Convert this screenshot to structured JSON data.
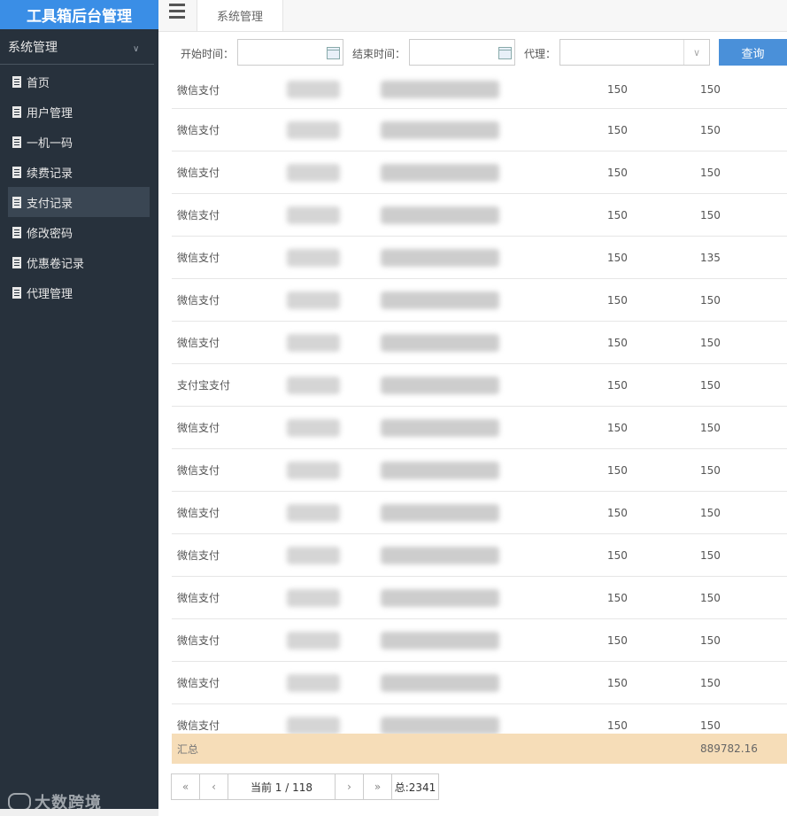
{
  "app": {
    "title": "工具箱后台管理"
  },
  "sidebar": {
    "group_label": "系统管理",
    "items": [
      {
        "label": "首页"
      },
      {
        "label": "用户管理"
      },
      {
        "label": "一机一码"
      },
      {
        "label": "续费记录"
      },
      {
        "label": "支付记录",
        "active": true
      },
      {
        "label": "修改密码"
      },
      {
        "label": "优惠卷记录"
      },
      {
        "label": "代理管理"
      }
    ],
    "watermark": "大数跨境"
  },
  "topbar": {
    "tab_label": "系统管理"
  },
  "filter": {
    "start_label": "开始时间：",
    "start_value": "",
    "end_label": "结束时间：",
    "end_value": "",
    "agent_label": "代理：",
    "agent_value": "",
    "query_label": "查询"
  },
  "table": {
    "rows": [
      {
        "method": "微信支付",
        "col3": "150",
        "col4": "150"
      },
      {
        "method": "微信支付",
        "col3": "150",
        "col4": "150"
      },
      {
        "method": "微信支付",
        "col3": "150",
        "col4": "150"
      },
      {
        "method": "微信支付",
        "col3": "150",
        "col4": "150"
      },
      {
        "method": "微信支付",
        "col3": "150",
        "col4": "135"
      },
      {
        "method": "微信支付",
        "col3": "150",
        "col4": "150"
      },
      {
        "method": "微信支付",
        "col3": "150",
        "col4": "150"
      },
      {
        "method": "支付宝支付",
        "col3": "150",
        "col4": "150"
      },
      {
        "method": "微信支付",
        "col3": "150",
        "col4": "150"
      },
      {
        "method": "微信支付",
        "col3": "150",
        "col4": "150"
      },
      {
        "method": "微信支付",
        "col3": "150",
        "col4": "150"
      },
      {
        "method": "微信支付",
        "col3": "150",
        "col4": "150"
      },
      {
        "method": "微信支付",
        "col3": "150",
        "col4": "150"
      },
      {
        "method": "微信支付",
        "col3": "150",
        "col4": "150"
      },
      {
        "method": "微信支付",
        "col3": "150",
        "col4": "150"
      },
      {
        "method": "微信支付",
        "col3": "150",
        "col4": "150"
      }
    ],
    "summary_label": "汇总",
    "summary_total": "889782.16"
  },
  "pager": {
    "first": "«",
    "prev": "‹",
    "current": "当前 1 / 118",
    "next": "›",
    "last": "»",
    "total": "总:2341"
  }
}
